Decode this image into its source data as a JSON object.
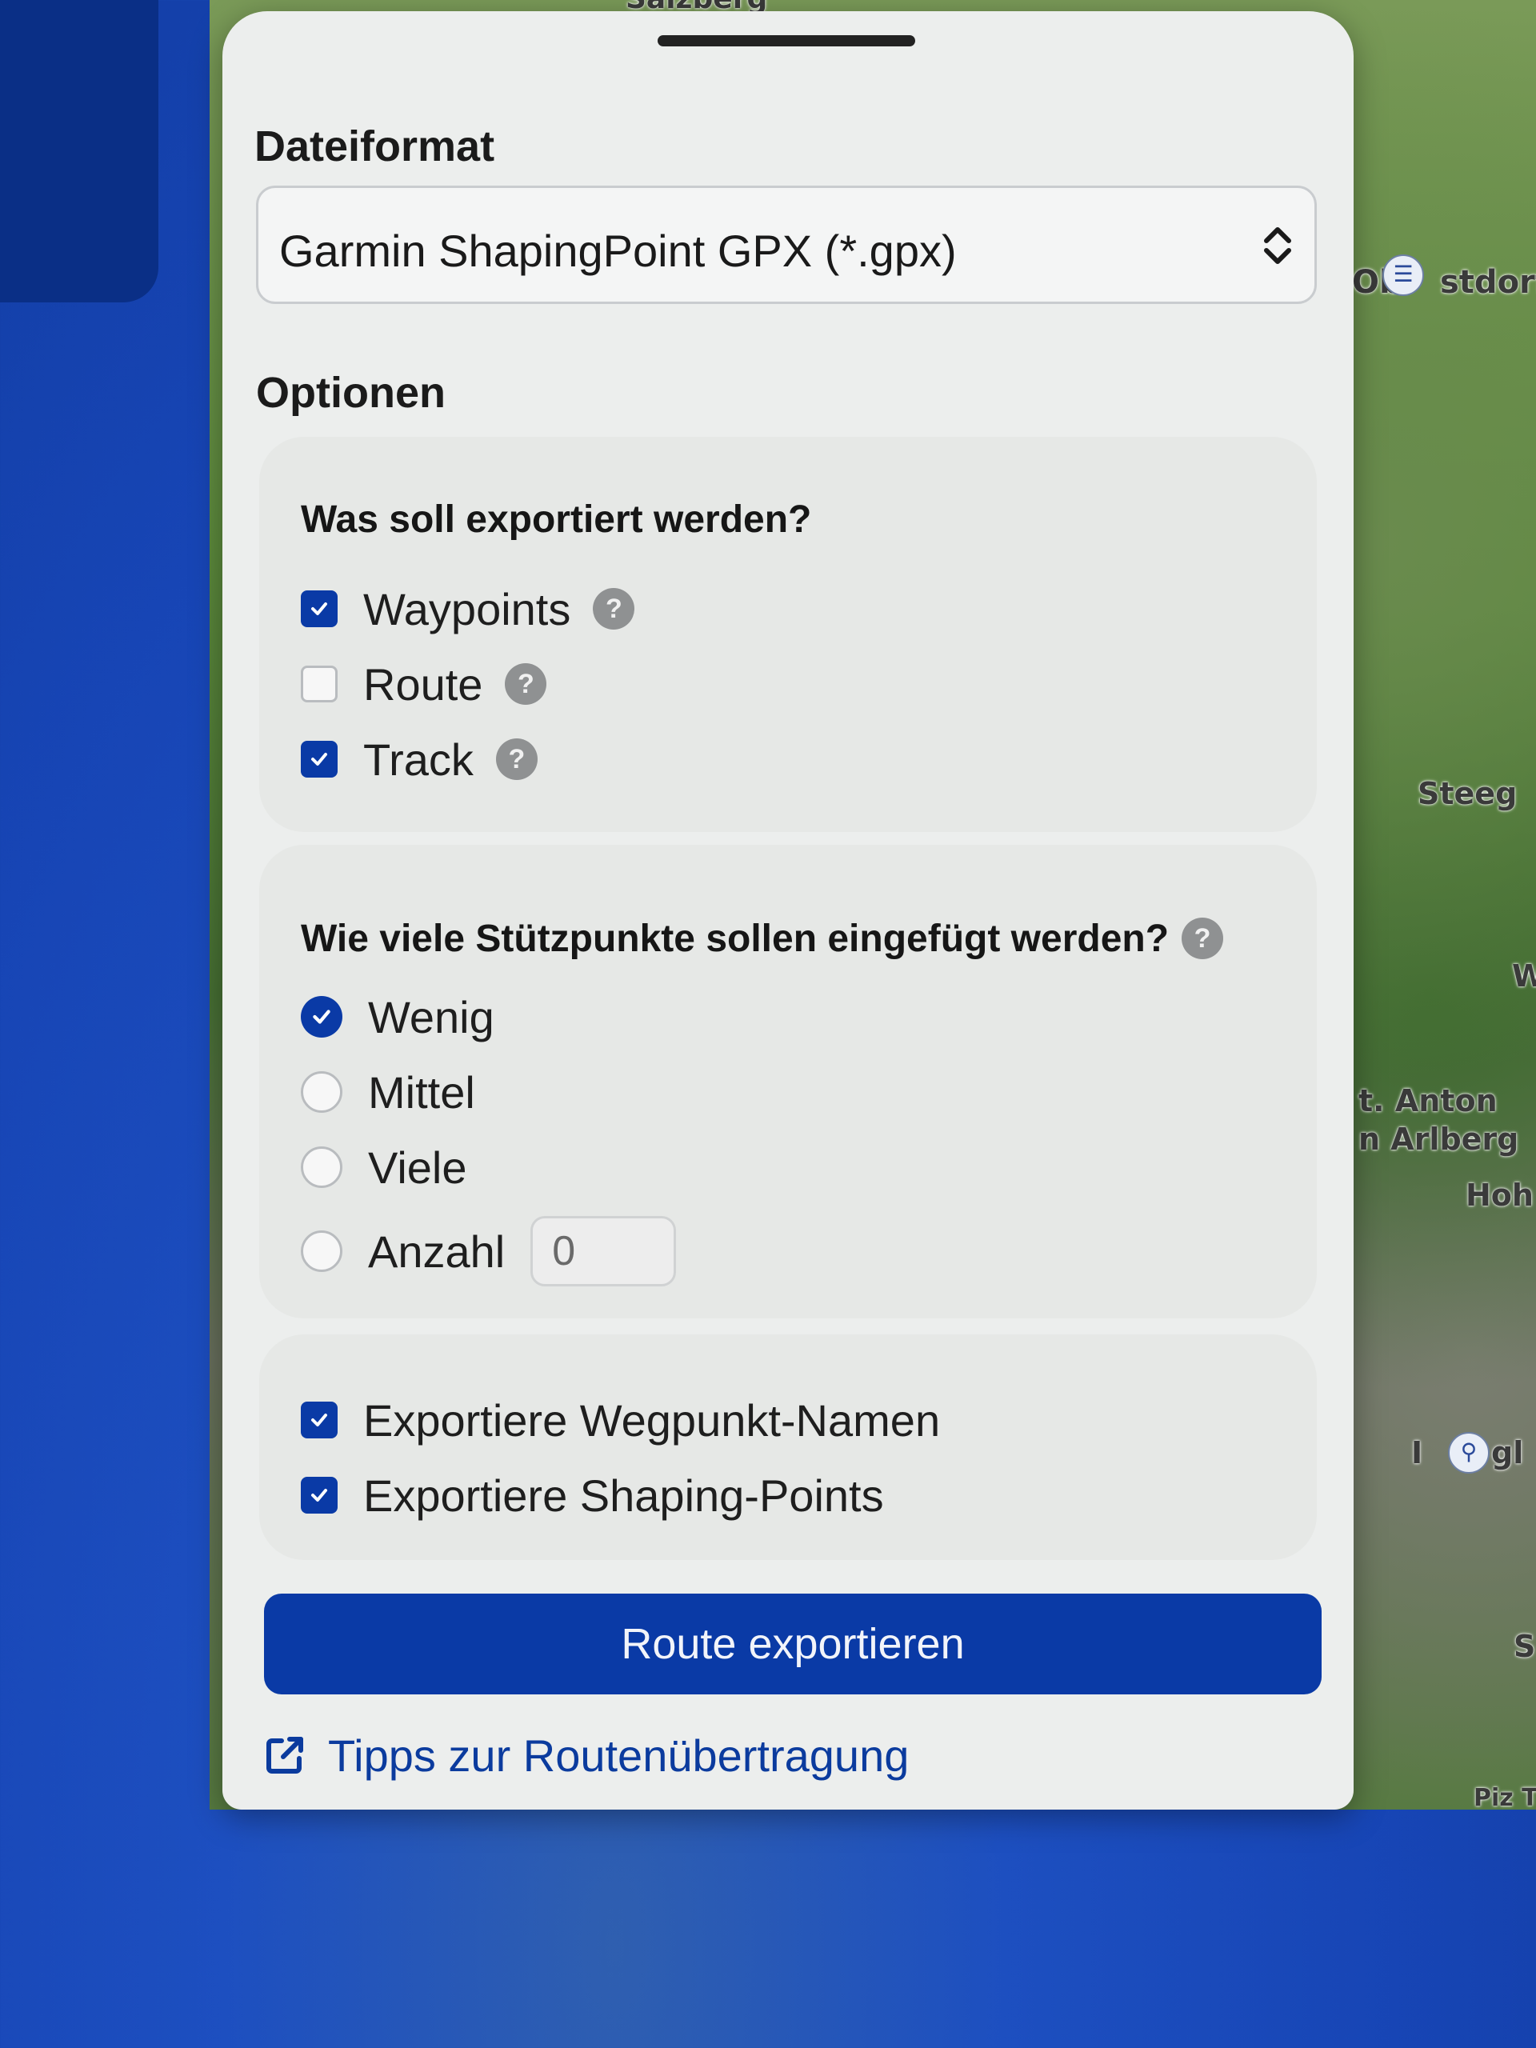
{
  "map": {
    "labels": [
      "Salzberg",
      "Ob",
      "stdorf",
      "Steeg",
      "t. Anton",
      "n Arlberg",
      "Hoh",
      "W",
      "I",
      "gl",
      "S",
      "Piz T"
    ]
  },
  "format_section": {
    "title": "Dateiformat",
    "selected_format": "Garmin ShapingPoint GPX (*.gpx)"
  },
  "options_section": {
    "title": "Optionen"
  },
  "export_what": {
    "title": "Was soll exportiert werden?",
    "items": [
      {
        "label": "Waypoints",
        "checked": true,
        "help": "?"
      },
      {
        "label": "Route",
        "checked": false,
        "help": "?"
      },
      {
        "label": "Track",
        "checked": true,
        "help": "?"
      }
    ]
  },
  "support_points": {
    "title": "Wie viele Stützpunkte sollen eingefügt werden?",
    "help": "?",
    "options": [
      {
        "label": "Wenig",
        "selected": true
      },
      {
        "label": "Mittel",
        "selected": false
      },
      {
        "label": "Viele",
        "selected": false
      },
      {
        "label": "Anzahl",
        "selected": false
      }
    ],
    "count_value": "0"
  },
  "extra_options": {
    "items": [
      {
        "label": "Exportiere Wegpunkt-Namen",
        "checked": true
      },
      {
        "label": "Exportiere Shaping-Points",
        "checked": true
      }
    ]
  },
  "actions": {
    "export_button": "Route exportieren",
    "tips_link": "Tipps zur Routenübertragung"
  },
  "colors": {
    "accent": "#0a3aa6",
    "panel_bg": "#eceeed",
    "card_bg": "#e6e8e6",
    "help_icon": "#8f9192"
  },
  "icons": {
    "select": "chevron-up-down-icon",
    "help": "question-circle-icon",
    "checkbox_checked": "check-icon",
    "tips": "external-link-icon"
  }
}
